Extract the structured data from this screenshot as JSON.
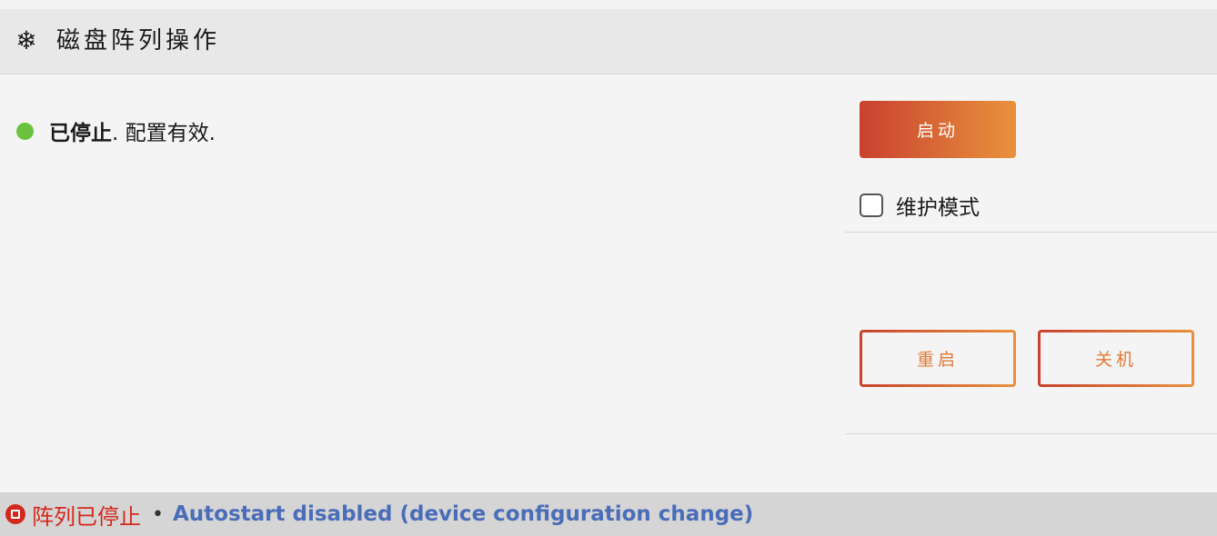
{
  "header": {
    "icon": "snowflake-icon",
    "title": "磁盘阵列操作"
  },
  "status": {
    "state": "已停止",
    "message": ". 配置有效.",
    "dot_color": "#6bc33d"
  },
  "actions": {
    "start_label": "启动",
    "maintenance_label": "维护模式",
    "maintenance_checked": false,
    "reboot_label": "重启",
    "shutdown_label": "关机",
    "accent_gradient": [
      "#c9412f",
      "#e8923d"
    ]
  },
  "footer": {
    "array_status": "阵列已停止",
    "separator": "•",
    "autostart_message": "Autostart disabled (device configuration change)"
  }
}
